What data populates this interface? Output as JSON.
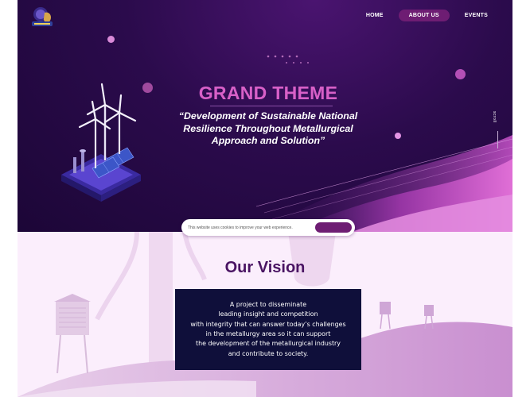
{
  "nav": {
    "items": [
      {
        "label": "HOME",
        "active": false
      },
      {
        "label": "ABOUT US",
        "active": true
      },
      {
        "label": "EVENTS",
        "active": false
      }
    ]
  },
  "hero": {
    "title": "GRAND THEME",
    "subtitle_lines": [
      "“Development of Sustainable National",
      "Resilience Throughout Metallurgical",
      "Approach and Solution”"
    ],
    "scroll_label": "scroll"
  },
  "cookie": {
    "text": "This website uses cookies to improve your web experience."
  },
  "vision": {
    "title": "Our Vision",
    "lines": [
      "A project to disseminate",
      "leading insight and competition",
      "with integrity that can answer today’s challenges",
      "in the metallurgy area so it can support",
      "the development of the metallurgical industry",
      "and contribute to society."
    ]
  },
  "colors": {
    "hero_bg": "#2b0b4c",
    "accent": "#6e1d73",
    "title_pink": "#d860c8",
    "vision_box": "#0f0f3a",
    "vision_title": "#4a1463"
  },
  "icons": [
    "logo-mascot",
    "wind-turbine-illustration",
    "windmill-tower-illustration",
    "water-tower-illustration"
  ]
}
